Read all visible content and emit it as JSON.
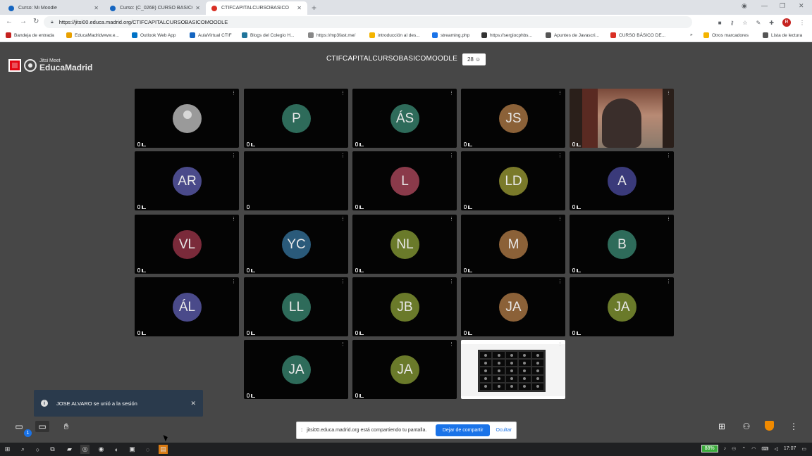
{
  "browser": {
    "tabs": [
      {
        "label": "Curso: Mi Moodle",
        "close": "✕",
        "favicon_color": "#1565c0"
      },
      {
        "label": "Curso: (C_0268) CURSO BÁSICO",
        "close": "✕",
        "favicon_color": "#1565c0"
      },
      {
        "label": "CTIFCAPITALCURSOBASICO",
        "close": "✕",
        "favicon_color": "#d93025"
      }
    ],
    "new_tab": "+",
    "url": "https://jitsi00.educa.madrid.org/CTIFCAPITALCURSOBASICOMOODLE",
    "bookmarks": [
      {
        "label": "Bandeja de entrada",
        "color": "#c5221f"
      },
      {
        "label": "EducaMadridwww.e...",
        "color": "#e8a000"
      },
      {
        "label": "Outlook Web App",
        "color": "#0072c6"
      },
      {
        "label": "AulaVirtual CTIF",
        "color": "#1565c0"
      },
      {
        "label": "Blogs del Colegio H...",
        "color": "#21759b"
      },
      {
        "label": "https://mp3fast.me/",
        "color": "#888888"
      },
      {
        "label": "introducción al des...",
        "color": "#f4b400"
      },
      {
        "label": "streaming.php",
        "color": "#1a73e8"
      },
      {
        "label": "https://sergiocphbs...",
        "color": "#333333"
      },
      {
        "label": "Apuntes de Javascri...",
        "color": "#555555"
      },
      {
        "label": "CURSO BÁSICO DE...",
        "color": "#d93025"
      },
      {
        "label": "»",
        "color": ""
      },
      {
        "label": "Otros marcadores",
        "color": "#f4b400"
      },
      {
        "label": "Lista de lectura",
        "color": "#555555"
      }
    ],
    "profile_initial": "R"
  },
  "header": {
    "logo_small": "Jitsi Meet",
    "logo_big": "EducaMadrid",
    "room_title": "CTIFCAPITALCURSOBASICOMOODLE",
    "participant_count": "28"
  },
  "tiles": [
    {
      "initials": "",
      "color": "#9a9a9a",
      "type": "placeholder"
    },
    {
      "initials": "P",
      "color": "#2e6b5a"
    },
    {
      "initials": "ÁS",
      "color": "#2e6b5a"
    },
    {
      "initials": "JS",
      "color": "#8b6138"
    },
    {
      "initials": "",
      "color": "",
      "type": "video"
    },
    {
      "initials": "AR",
      "color": "#4a4a8a"
    },
    {
      "initials": "",
      "color": "",
      "type": "empty"
    },
    {
      "initials": "L",
      "color": "#8a3a4a"
    },
    {
      "initials": "LD",
      "color": "#7a7a2a"
    },
    {
      "initials": "A",
      "color": "#3a3a7a"
    },
    {
      "initials": "VL",
      "color": "#7a2a3a"
    },
    {
      "initials": "YC",
      "color": "#2a5a7a"
    },
    {
      "initials": "NL",
      "color": "#6a7a2a"
    },
    {
      "initials": "M",
      "color": "#8b6138"
    },
    {
      "initials": "B",
      "color": "#2e6b5a"
    },
    {
      "initials": "ÁL",
      "color": "#4a4a8a"
    },
    {
      "initials": "LL",
      "color": "#2e6b5a"
    },
    {
      "initials": "JB",
      "color": "#6a7a2a"
    },
    {
      "initials": "JA",
      "color": "#8b6138"
    },
    {
      "initials": "JA",
      "color": "#6a7a2a"
    },
    {
      "initials": "JA",
      "color": "#2e6b5a"
    },
    {
      "initials": "JA",
      "color": "#6a7a2a"
    },
    {
      "initials": "",
      "color": "",
      "type": "screenshare"
    }
  ],
  "notification": {
    "text": "JOSE ALVARO se unió a la sesión",
    "close": "✕"
  },
  "toolbar": {
    "chat_badge": "1"
  },
  "share_bar": {
    "message": "jitsi00.educa.madrid.org está compartiendo tu pantalla.",
    "stop_label": "Dejar de compartir",
    "hide_label": "Ocultar"
  },
  "taskbar": {
    "battery": "88%",
    "time": "17:07"
  }
}
